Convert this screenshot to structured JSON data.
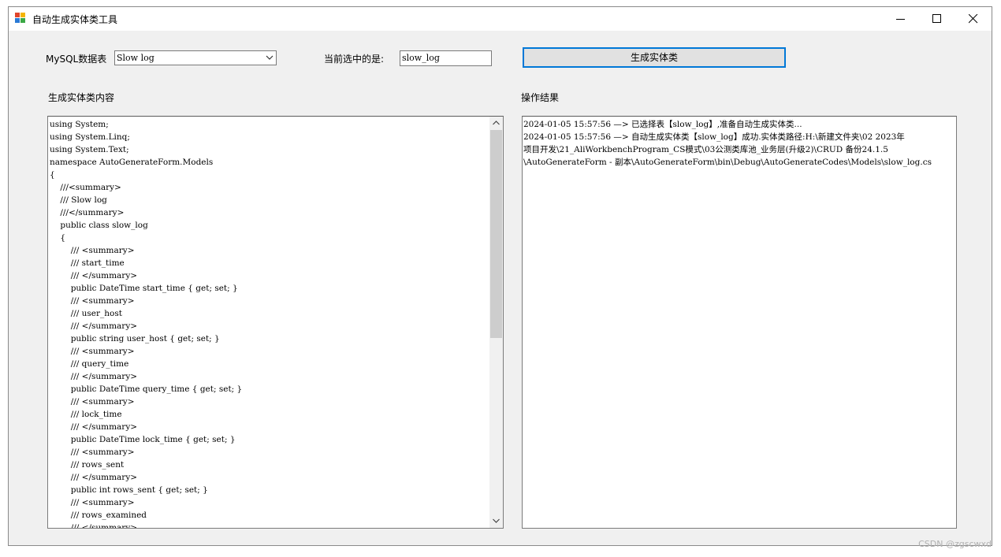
{
  "window": {
    "title": "自动生成实体类工具",
    "icon": "winforms-app-icon"
  },
  "controls": {
    "table_label": "MySQL数据表",
    "table_combo_value": "Slow log",
    "selected_label": "当前选中的是:",
    "selected_value": "slow_log",
    "generate_button": "生成实体类"
  },
  "code_panel": {
    "label": "生成实体类内容",
    "lines": [
      "using System;",
      "using System.Linq;",
      "using System.Text;",
      "namespace AutoGenerateForm.Models",
      "{",
      "    ///<summary>",
      "    /// Slow log",
      "    ///</summary>",
      "    public class slow_log",
      "    {",
      "        /// <summary>",
      "        /// start_time",
      "        /// </summary>",
      "        public DateTime start_time { get; set; }",
      "        /// <summary>",
      "        /// user_host",
      "        /// </summary>",
      "        public string user_host { get; set; }",
      "        /// <summary>",
      "        /// query_time",
      "        /// </summary>",
      "        public DateTime query_time { get; set; }",
      "        /// <summary>",
      "        /// lock_time",
      "        /// </summary>",
      "        public DateTime lock_time { get; set; }",
      "        /// <summary>",
      "        /// rows_sent",
      "        /// </summary>",
      "        public int rows_sent { get; set; }",
      "        /// <summary>",
      "        /// rows_examined",
      "        /// </summary>"
    ]
  },
  "result_panel": {
    "label": "操作结果",
    "lines": [
      "2024-01-05 15:57:56 —> 已选择表【slow_log】,准备自动生成实体类...",
      "2024-01-05 15:57:56 —> 自动生成实体类【slow_log】成功.实体类路径:H:\\新建文件夹\\02 2023年",
      "项目开发\\21_AliWorkbenchProgram_CS模式\\03公测类库池_业务层(升级2)\\CRUD 备份24.1.5",
      "\\AutoGenerateForm - 副本\\AutoGenerateForm\\bin\\Debug\\AutoGenerateCodes\\Models\\slow_log.cs"
    ]
  },
  "watermark": "CSDN @zgscwxd",
  "colors": {
    "accent": "#0078d7",
    "window_bg": "#f0f0f0",
    "button_bg": "#e1e1e1"
  }
}
